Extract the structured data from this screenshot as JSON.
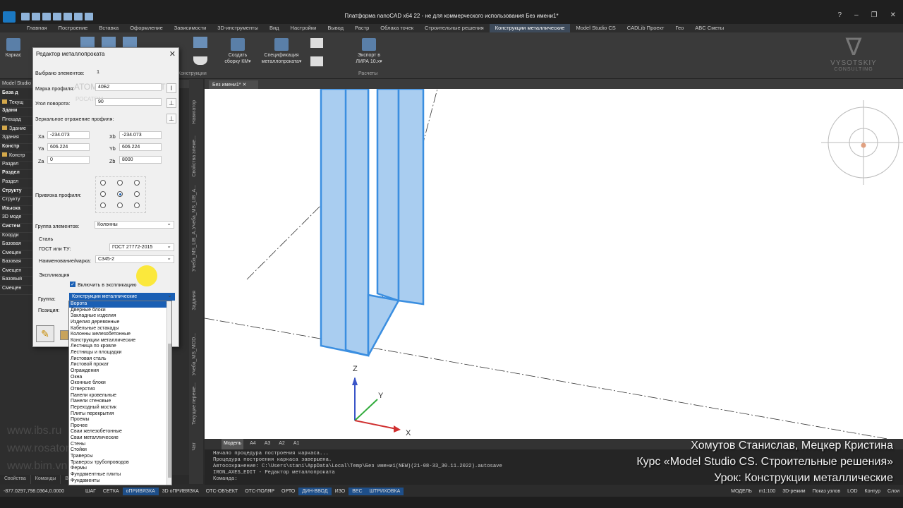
{
  "window": {
    "title": "Платформа nanoCAD x64 22 - не для коммерческого использования Без имени1*"
  },
  "menu": {
    "tabs": [
      "Главная",
      "Построение",
      "Вставка",
      "Оформление",
      "Зависимости",
      "3D-инструменты",
      "Вид",
      "Настройки",
      "Вывод",
      "Растр",
      "Облака точек",
      "Строительные решения",
      "Конструкции металлические",
      "Model Studio CS",
      "CADLib Проект",
      "Гео",
      "ABC Сметы"
    ],
    "active": "Конструкции металлические"
  },
  "ribbon": {
    "karkas": "Каркас",
    "create_km": "Создать\nсборку КМ▾",
    "spec": "Спецификация\nметаллопроката▾",
    "export": "Экспорт в\nЛИРА 10.х▾",
    "group_label": "Расчеты",
    "constructions_label": "Конструкции"
  },
  "watermark": {
    "brand": "VYSOTSKIY",
    "sub": "CONSULTING"
  },
  "left_panel": {
    "header": "Model Studio",
    "tree": [
      {
        "t": "База д",
        "b": true
      },
      {
        "t": "Текущ",
        "ic": true
      },
      {
        "t": "Здани",
        "b": true
      },
      {
        "t": "Площад"
      },
      {
        "t": "Здание",
        "ic": true
      },
      {
        "t": "Здания"
      },
      {
        "t": "Констр",
        "b": true
      },
      {
        "t": "Констр",
        "ic": true
      },
      {
        "t": "Раздел"
      },
      {
        "t": "Раздел",
        "b": true
      },
      {
        "t": "Раздел"
      },
      {
        "t": "Структу",
        "b": true
      },
      {
        "t": "Структу"
      },
      {
        "t": "Изыска",
        "b": true
      },
      {
        "t": "3D моде"
      },
      {
        "t": "Систем",
        "b": true
      },
      {
        "t": "Коорди"
      },
      {
        "t": "Базовая"
      },
      {
        "t": "Смещен"
      },
      {
        "t": "Базовая"
      },
      {
        "t": "Смещен"
      },
      {
        "t": "Базовый"
      },
      {
        "t": "Смещен"
      }
    ]
  },
  "side_tabs": [
    "Навигатор",
    "Свойства элеме...",
    "Учеба_MS_LIB_A...",
    "Учеба_MS_LIB_A...",
    "Задания",
    "Учеба_MS_MOD...",
    "Текущие переме...",
    "Чат"
  ],
  "left_bottom_tabs": [
    "Свойства",
    "Команды",
    "Ви...",
    "...ификация"
  ],
  "web_watermarks": [
    "www.ibs.ru",
    "www.rosatom.ru",
    "www.bim.vn"
  ],
  "dialog": {
    "title": "Редактор металлопроката",
    "selected_label": "Выбрано элементов:",
    "selected_value": "1",
    "profile_label": "Марка профиля:",
    "profile_value": "40Б2",
    "angle_label": "Угол поворота:",
    "angle_value": "90",
    "mirror_label": "Зеркальное отражение профиля:",
    "xa_label": "Xa",
    "xa": "-234.073",
    "xb_label": "Xb",
    "xb": "-234.073",
    "ya_label": "Ya",
    "ya": "606.224",
    "yb_label": "Yb",
    "yb": "606.224",
    "za_label": "Za",
    "za": "0",
    "zb_label": "Zb",
    "zb": "8000",
    "anchor_label": "Привязка профиля:",
    "group_label": "Группа элементов:",
    "group_value": "Колонны",
    "steel_label": "Сталь",
    "gost_label": "ГОСТ или ТУ:",
    "gost_value": "ГОСТ 27772-2015",
    "grade_label": "Наименование/марка:",
    "grade_value": "С345-2",
    "expl_label": "Экспликация",
    "include_label": "Включить в экспликацию",
    "grp_label": "Группа:",
    "grp_value": "Конструкции металлические",
    "pos_label": "Позиция:",
    "bg_logo": "АТОМЭНЕРГОПРОЕКТ",
    "bg_logo2": "РОСАТОМ"
  },
  "dropdown": {
    "selected": "Ворота",
    "items": [
      "Ворота",
      "Дверные блоки",
      "Закладные изделия",
      "Изделия деревянные",
      "Кабельные эстакады",
      "Колонны железобетонные",
      "Конструкции металлические",
      "Лестница по кровле",
      "Лестницы и площадки",
      "Листовая сталь",
      "Листовой прокат",
      "Ограждения",
      "Окна",
      "Оконные блоки",
      "Отверстия",
      "Панели кровельные",
      "Панели стеновые",
      "Переходный мостик",
      "Плиты перекрытия",
      "Проемы",
      "Прочее",
      "Сваи железобетонные",
      "Сваи металлические",
      "Стены",
      "Стойки",
      "Траверсы",
      "Траверсы трубопроводов",
      "Фермы",
      "Фундаментные плиты",
      "Фундаменты"
    ]
  },
  "viewport": {
    "tab": "Без имени1*",
    "axis_z": "Z",
    "axis_y": "Y",
    "axis_x": "X"
  },
  "layout_tabs": [
    "Модель",
    "A4",
    "A3",
    "A2",
    "A1"
  ],
  "command_lines": [
    "Начало процедура построения каркаса...",
    "Процедура построения каркаса завершена.",
    "Автосохранение: C:\\Users\\stani\\AppData\\Local\\Temp\\Без имени1(NEW)(21-08-33_30.11.2022).autosave",
    "IRON_AXES_EDIT - Редактор металлопроката",
    "Команда:"
  ],
  "overlay": {
    "authors": "Хомутов Станислав, Мецкер Кристина",
    "course": "Курс «Model Studio CS. Строительные решения»",
    "lesson": "Урок: Конструкции металлические"
  },
  "statusbar": {
    "coords": "-877.0297,798.0364,0.0000",
    "items": [
      {
        "t": "ШАГ",
        "on": false
      },
      {
        "t": "СЕТКА",
        "on": false
      },
      {
        "t": "оПРИВЯЗКА",
        "on": true
      },
      {
        "t": "3D оПРИВЯЗКА",
        "on": false
      },
      {
        "t": "ОТС-ОБЪЕКТ",
        "on": false
      },
      {
        "t": "ОТС-ПОЛЯР",
        "on": false
      },
      {
        "t": "ОРТО",
        "on": false
      },
      {
        "t": "ДИН-ВВОД",
        "on": true
      },
      {
        "t": "ИЗО",
        "on": false
      },
      {
        "t": "ВЕС",
        "on": true
      },
      {
        "t": "ШТРИХОВКА",
        "on": true
      }
    ],
    "right": [
      "МОДЕЛЬ",
      "m1:100",
      "3D-режим",
      "Показ узлов",
      "LOD",
      "Контур",
      "Слои"
    ]
  },
  "colors": {
    "accent": "#1a5fb4",
    "profile_fill": "#a9cdf0",
    "profile_stroke": "#3a8ee0"
  }
}
